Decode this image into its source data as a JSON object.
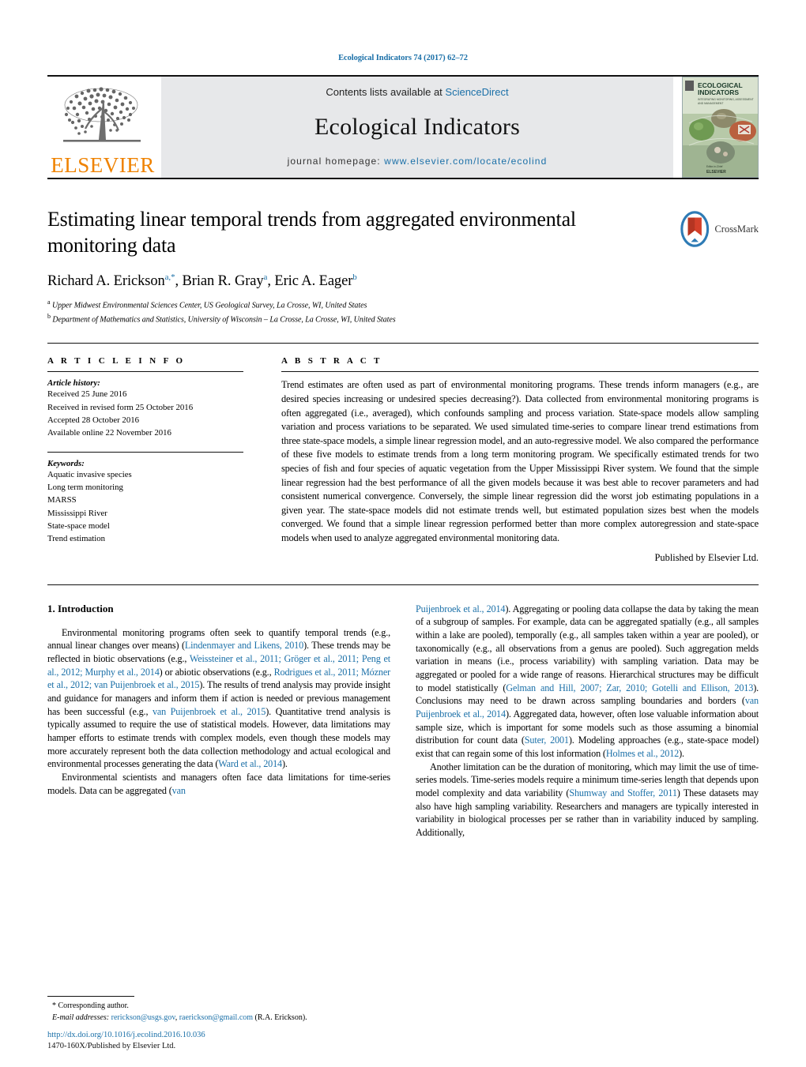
{
  "running_head": "Ecological Indicators 74 (2017) 62–72",
  "masthead": {
    "publisher_logo_label": "ELSEVIER",
    "contents_prefix": "Contents lists available at ",
    "contents_link": "ScienceDirect",
    "journal_title": "Ecological Indicators",
    "homepage_prefix": "journal homepage: ",
    "homepage_link": "www.elsevier.com/locate/ecolind",
    "cover_title_line1": "ECOLOGICAL",
    "cover_title_line2": "INDICATORS",
    "cover_subtitle": "INTEGRATING MONITORING, ASSESSMENT AND MANAGEMENT",
    "cover_footer": "ELSEVIER"
  },
  "article": {
    "title": "Estimating linear temporal trends from aggregated environmental monitoring data",
    "crossmark_label": "CrossMark",
    "authors_html": "Richard A. Erickson<sup>a,*</sup>, Brian R. Gray<sup>a</sup>, Eric A. Eager<sup>b</sup>",
    "affiliations": [
      "Upper Midwest Environmental Sciences Center, US Geological Survey, La Crosse, WI, United States",
      "Department of Mathematics and Statistics, University of Wisconsin – La Crosse, La Crosse, WI, United States"
    ],
    "affiliation_marks": [
      "a",
      "b"
    ]
  },
  "article_info": {
    "heading": "A R T I C L E   I N F O",
    "history_heading": "Article history:",
    "history": [
      "Received 25 June 2016",
      "Received in revised form 25 October 2016",
      "Accepted 28 October 2016",
      "Available online 22 November 2016"
    ],
    "keywords_heading": "Keywords:",
    "keywords": [
      "Aquatic invasive species",
      "Long term monitoring",
      "MARSS",
      "Mississippi River",
      "State-space model",
      "Trend estimation"
    ]
  },
  "abstract": {
    "heading": "A B S T R A C T",
    "text": "Trend estimates are often used as part of environmental monitoring programs. These trends inform managers (e.g., are desired species increasing or undesired species decreasing?). Data collected from environmental monitoring programs is often aggregated (i.e., averaged), which confounds sampling and process variation. State-space models allow sampling variation and process variations to be separated. We used simulated time-series to compare linear trend estimations from three state-space models, a simple linear regression model, and an auto-regressive model. We also compared the performance of these five models to estimate trends from a long term monitoring program. We specifically estimated trends for two species of fish and four species of aquatic vegetation from the Upper Mississippi River system. We found that the simple linear regression had the best performance of all the given models because it was best able to recover parameters and had consistent numerical convergence. Conversely, the simple linear regression did the worst job estimating populations in a given year. The state-space models did not estimate trends well, but estimated population sizes best when the models converged. We found that a simple linear regression performed better than more complex autoregression and state-space models when used to analyze aggregated environmental monitoring data.",
    "copyright": "Published by Elsevier Ltd."
  },
  "body": {
    "section_heading": "1. Introduction",
    "left_paragraphs": [
      "Environmental monitoring programs often seek to quantify temporal trends (e.g., annual linear changes over means) (<span class=\"ref\">Lindenmayer and Likens, 2010</span>). These trends may be reflected in biotic observations (e.g., <span class=\"ref\">Weissteiner et al., 2011; Gröger et al., 2011; Peng et al., 2012; Murphy et al., 2014</span>) or abiotic observations (e.g., <span class=\"ref\">Rodrigues et al., 2011; Mózner et al., 2012; van Puijenbroek et al., 2015</span>). The results of trend analysis may provide insight and guidance for managers and inform them if action is needed or previous management has been successful (e.g., <span class=\"ref\">van Puijenbroek et al., 2015</span>). Quantitative trend analysis is typically assumed to require the use of statistical models. However, data limitations may hamper efforts to estimate trends with complex models, even though these models may more accurately represent both the data collection methodology and actual ecological and environmental processes generating the data (<span class=\"ref\">Ward et al., 2014</span>).",
      "Environmental scientists and managers often face data limitations for time-series models. Data can be aggregated (<span class=\"ref\">van</span>"
    ],
    "right_paragraphs": [
      "<span class=\"ref\">Puijenbroek et al., 2014</span>). Aggregating or pooling data collapse the data by taking the mean of a subgroup of samples. For example, data can be aggregated spatially (e.g., all samples within a lake are pooled), temporally (e.g., all samples taken within a year are pooled), or taxonomically (e.g., all observations from a genus are pooled). Such aggregation melds variation in means (i.e., process variability) with sampling variation. Data may be aggregated or pooled for a wide range of reasons. Hierarchical structures may be difficult to model statistically (<span class=\"ref\">Gelman and Hill, 2007; Zar, 2010; Gotelli and Ellison, 2013</span>). Conclusions may need to be drawn across sampling boundaries and borders (<span class=\"ref\">van Puijenbroek et al., 2014</span>). Aggregated data, however, often lose valuable information about sample size, which is important for some models such as those assuming a binomial distribution for count data (<span class=\"ref\">Suter, 2001</span>). Modeling approaches (e.g., state-space model) exist that can regain some of this lost information (<span class=\"ref\">Holmes et al., 2012</span>).",
      "Another limitation can be the duration of monitoring, which may limit the use of time-series models. Time-series models require a minimum time-series length that depends upon model complexity and data variability (<span class=\"ref\">Shumway and Stoffer, 2011</span>) These datasets may also have high sampling variability. Researchers and managers are typically interested in variability in biological processes per se rather than in variability induced by sampling. Additionally,"
    ]
  },
  "footnote": {
    "corresponding_marker": "*",
    "corresponding_text": "Corresponding author.",
    "email_label": "E-mail addresses:",
    "email_1": "rerickson@usgs.gov",
    "email_separator": ", ",
    "email_2": "raerickson@gmail.com",
    "email_suffix": " (R.A. Erickson)."
  },
  "doi_block": {
    "doi_url": "http://dx.doi.org/10.1016/j.ecolind.2016.10.036",
    "issn_line": "1470-160X/Published by Elsevier Ltd."
  },
  "colors": {
    "link": "#1b70a8",
    "elsevier_orange": "#ef8200",
    "masthead_gray": "#e7e8ea",
    "rule": "#111111"
  }
}
